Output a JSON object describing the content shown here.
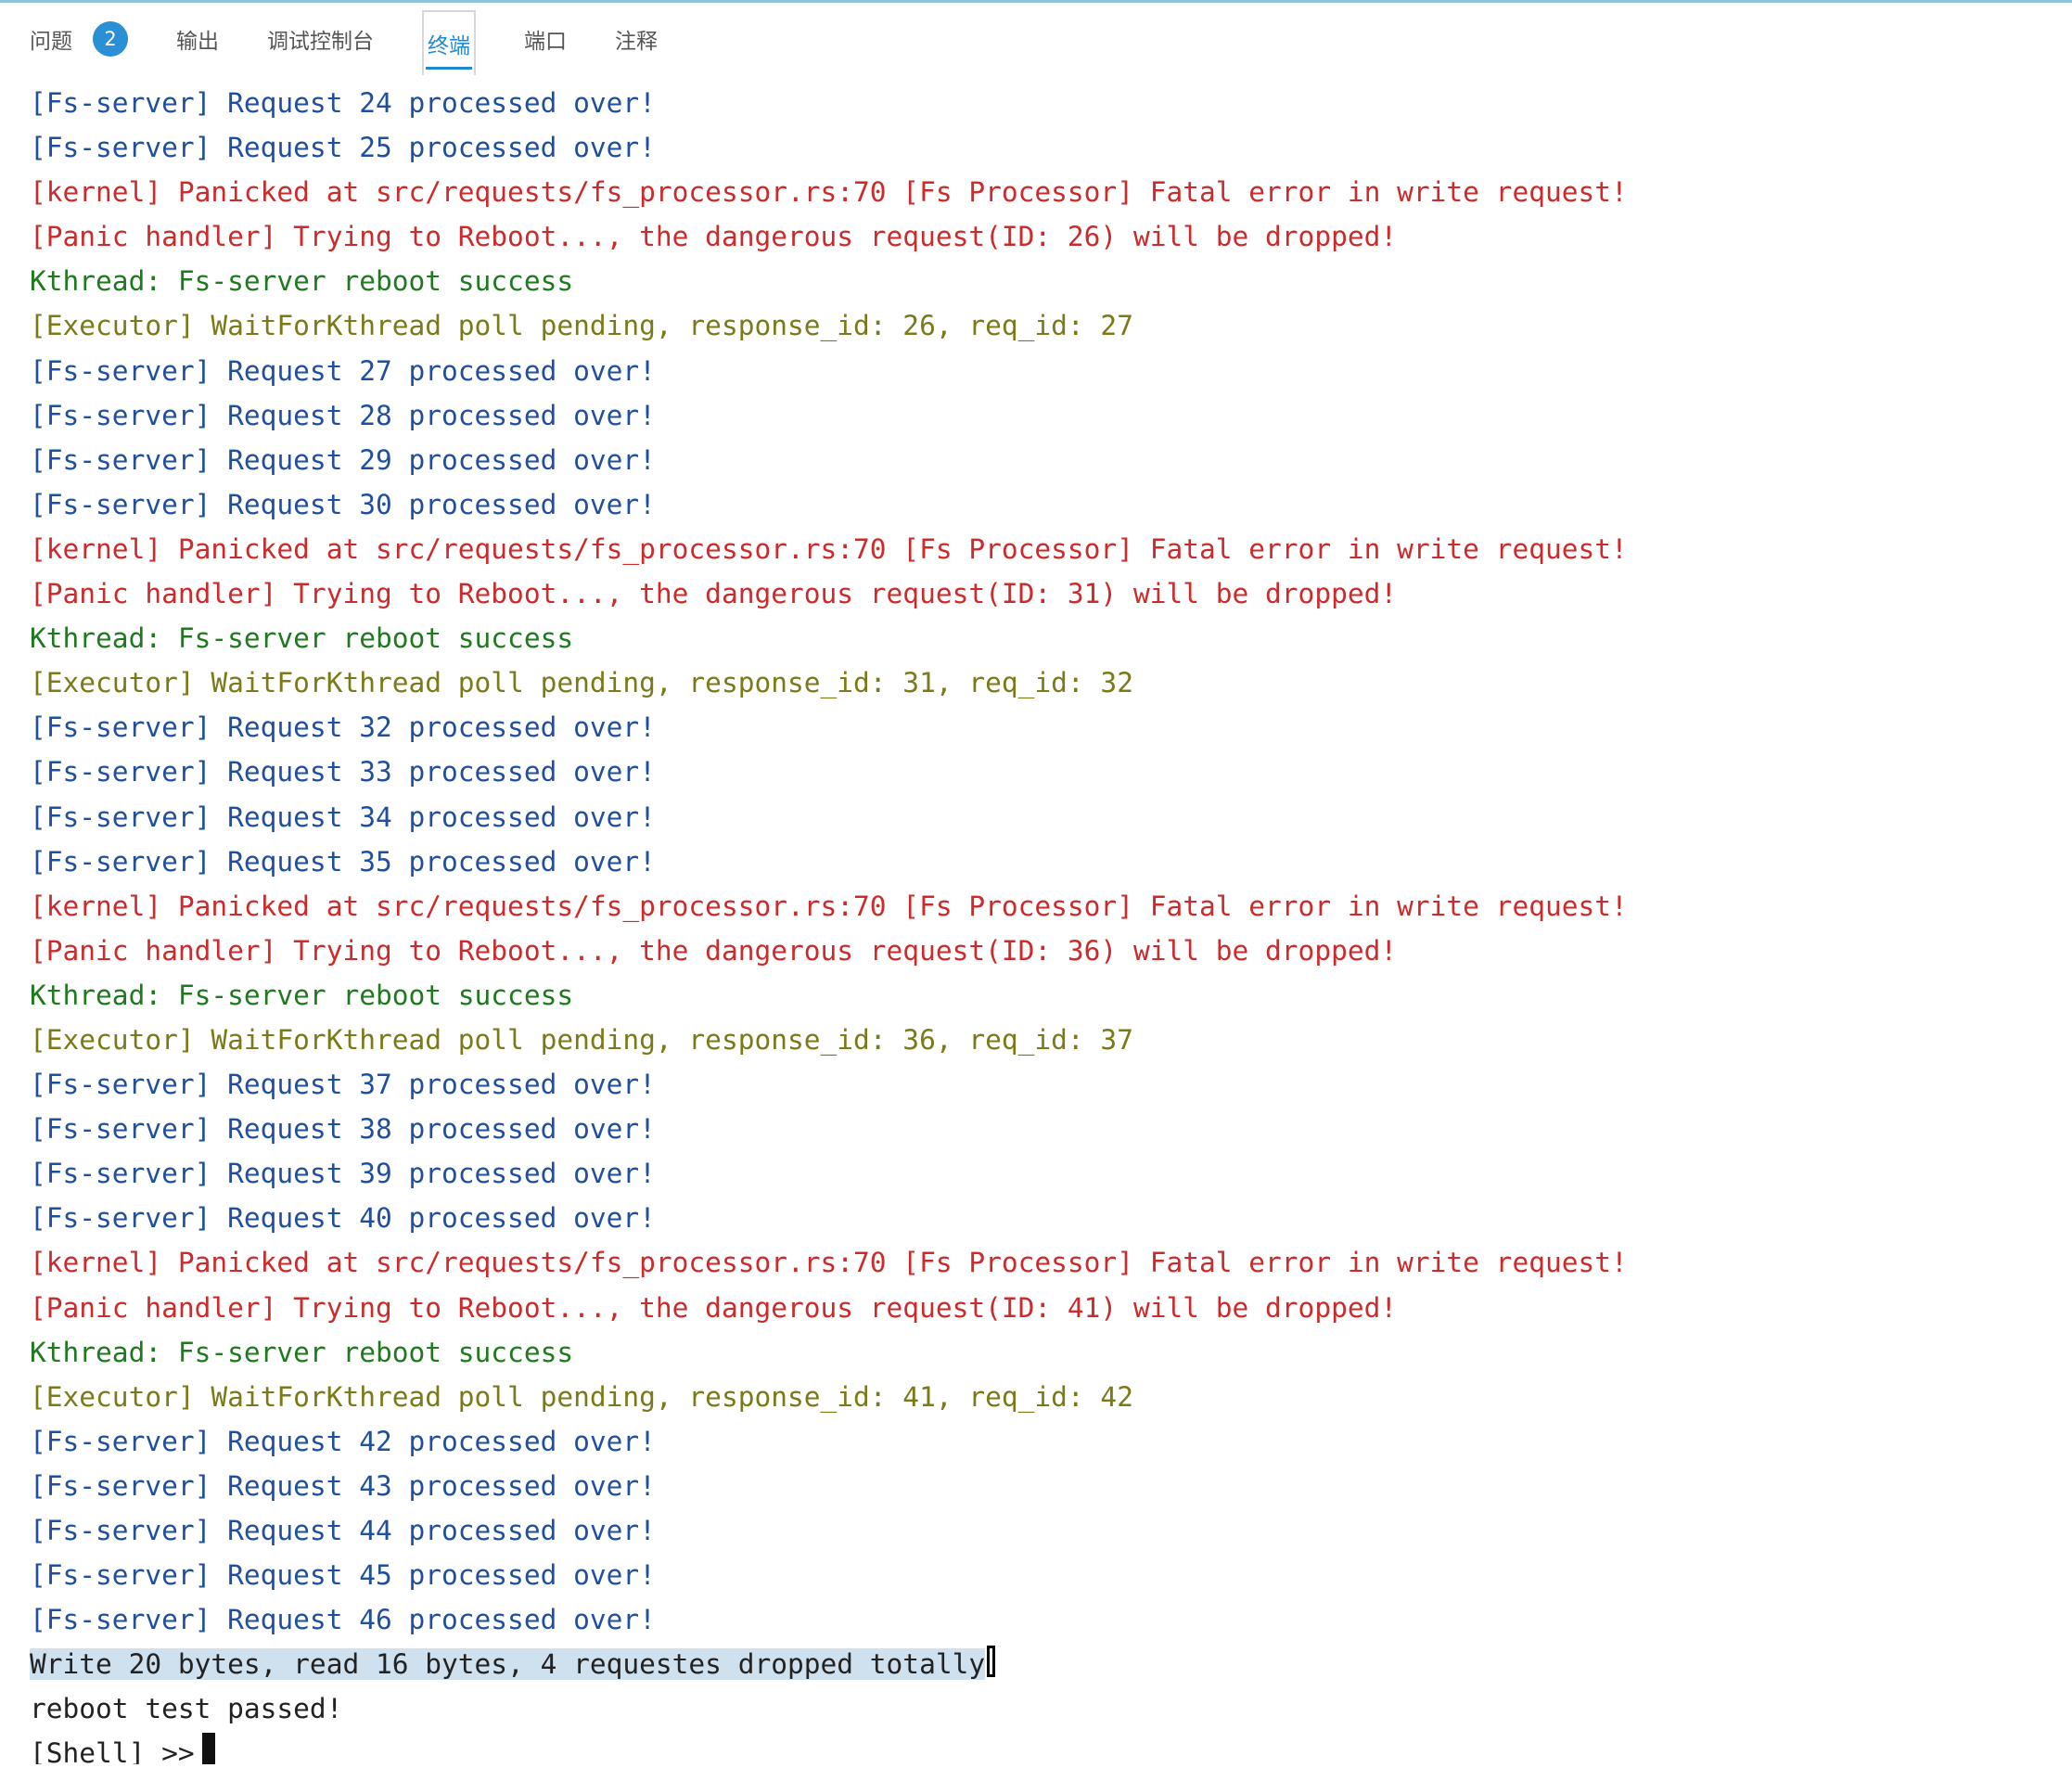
{
  "colors": {
    "accent": "#1f8ad2",
    "fs_server": "#1f4f9e",
    "panic": "#cd2b2b",
    "kthread": "#1f7a1f",
    "executor": "#7a7a18",
    "selection": "#cfe0ef"
  },
  "panel": {
    "tabs": [
      {
        "label": "问题",
        "badge": "2"
      },
      {
        "label": "输出"
      },
      {
        "label": "调试控制台"
      },
      {
        "label": "终端",
        "active": true
      },
      {
        "label": "端口"
      },
      {
        "label": "注释"
      }
    ]
  },
  "terminal": {
    "lines": [
      "[Fs-server] Request 24 processed over!",
      "[Fs-server] Request 25 processed over!",
      "[kernel] Panicked at src/requests/fs_processor.rs:70 [Fs Processor] Fatal error in write request!",
      "[Panic handler] Trying to Reboot..., the dangerous request(ID: 26) will be dropped!",
      "Kthread: Fs-server reboot success",
      "[Executor] WaitForKthread poll pending, response_id: 26, req_id: 27",
      "[Fs-server] Request 27 processed over!",
      "[Fs-server] Request 28 processed over!",
      "[Fs-server] Request 29 processed over!",
      "[Fs-server] Request 30 processed over!",
      "[kernel] Panicked at src/requests/fs_processor.rs:70 [Fs Processor] Fatal error in write request!",
      "[Panic handler] Trying to Reboot..., the dangerous request(ID: 31) will be dropped!",
      "Kthread: Fs-server reboot success",
      "[Executor] WaitForKthread poll pending, response_id: 31, req_id: 32",
      "[Fs-server] Request 32 processed over!",
      "[Fs-server] Request 33 processed over!",
      "[Fs-server] Request 34 processed over!",
      "[Fs-server] Request 35 processed over!",
      "[kernel] Panicked at src/requests/fs_processor.rs:70 [Fs Processor] Fatal error in write request!",
      "[Panic handler] Trying to Reboot..., the dangerous request(ID: 36) will be dropped!",
      "Kthread: Fs-server reboot success",
      "[Executor] WaitForKthread poll pending, response_id: 36, req_id: 37",
      "[Fs-server] Request 37 processed over!",
      "[Fs-server] Request 38 processed over!",
      "[Fs-server] Request 39 processed over!",
      "[Fs-server] Request 40 processed over!",
      "[kernel] Panicked at src/requests/fs_processor.rs:70 [Fs Processor] Fatal error in write request!",
      "[Panic handler] Trying to Reboot..., the dangerous request(ID: 41) will be dropped!",
      "Kthread: Fs-server reboot success",
      "[Executor] WaitForKthread poll pending, response_id: 41, req_id: 42",
      "[Fs-server] Request 42 processed over!",
      "[Fs-server] Request 43 processed over!",
      "[Fs-server] Request 44 processed over!",
      "[Fs-server] Request 45 processed over!",
      "[Fs-server] Request 46 processed over!",
      "Write 20 bytes, read 16 bytes, 4 requestes dropped totally",
      "reboot test passed!"
    ],
    "prompt": "[Shell] >>"
  }
}
